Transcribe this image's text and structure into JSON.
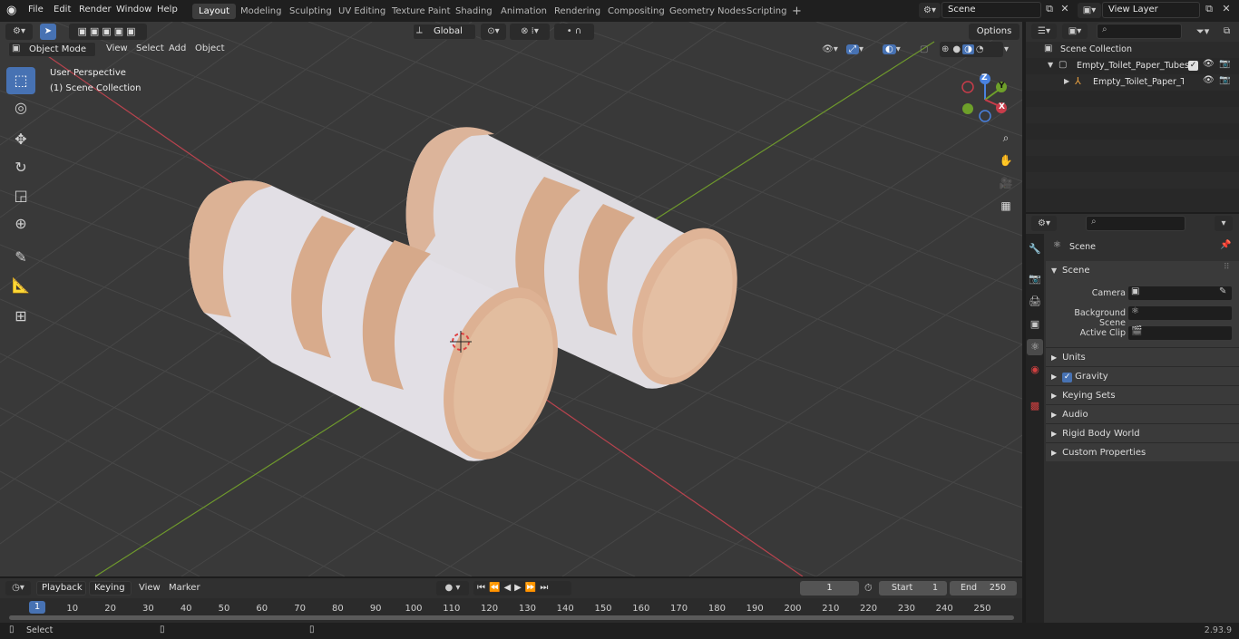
{
  "menus": [
    "File",
    "Edit",
    "Render",
    "Window",
    "Help"
  ],
  "workspaces": [
    "Layout",
    "Modeling",
    "Sculpting",
    "UV Editing",
    "Texture Paint",
    "Shading",
    "Animation",
    "Rendering",
    "Compositing",
    "Geometry Nodes",
    "Scripting",
    "+"
  ],
  "scene_field": "Scene",
  "view_layer_field": "View Layer",
  "viewport": {
    "mode": "Object Mode",
    "menus": [
      "View",
      "Select",
      "Add",
      "Object"
    ],
    "transform_orientation": "Global",
    "options_label": "Options",
    "overlay_title": "User Perspective",
    "overlay_subtitle": "(1) Scene Collection",
    "gizmo": {
      "z": "Z",
      "y": "Y",
      "x": "X"
    }
  },
  "outliner": {
    "root": "Scene Collection",
    "items": [
      "Empty_Toilet_Paper_Tubes",
      "Empty_Toilet_Paper_Tube"
    ]
  },
  "properties": {
    "header": "Scene",
    "section": "Scene",
    "camera_label": "Camera",
    "bg_scene_label": "Background Scene",
    "active_clip_label": "Active Clip",
    "panels": [
      "Units",
      "Gravity",
      "Keying Sets",
      "Audio",
      "Rigid Body World",
      "Custom Properties"
    ],
    "gravity_checked": true
  },
  "timeline": {
    "menus": [
      "Playback",
      "Keying",
      "View",
      "Marker"
    ],
    "current_frame": "1",
    "start_label": "Start",
    "start": "1",
    "end_label": "End",
    "end": "250",
    "ticks": [
      "1",
      "10",
      "20",
      "30",
      "40",
      "50",
      "60",
      "70",
      "80",
      "90",
      "100",
      "110",
      "120",
      "130",
      "140",
      "150",
      "160",
      "170",
      "180",
      "190",
      "200",
      "210",
      "220",
      "230",
      "240",
      "250"
    ]
  },
  "status": {
    "left": "Select",
    "version": "2.93.9"
  },
  "colors": {
    "accent": "#4772b3",
    "x_axis": "#c83c4a",
    "y_axis": "#6ea02a",
    "z_axis": "#4a82e0"
  }
}
